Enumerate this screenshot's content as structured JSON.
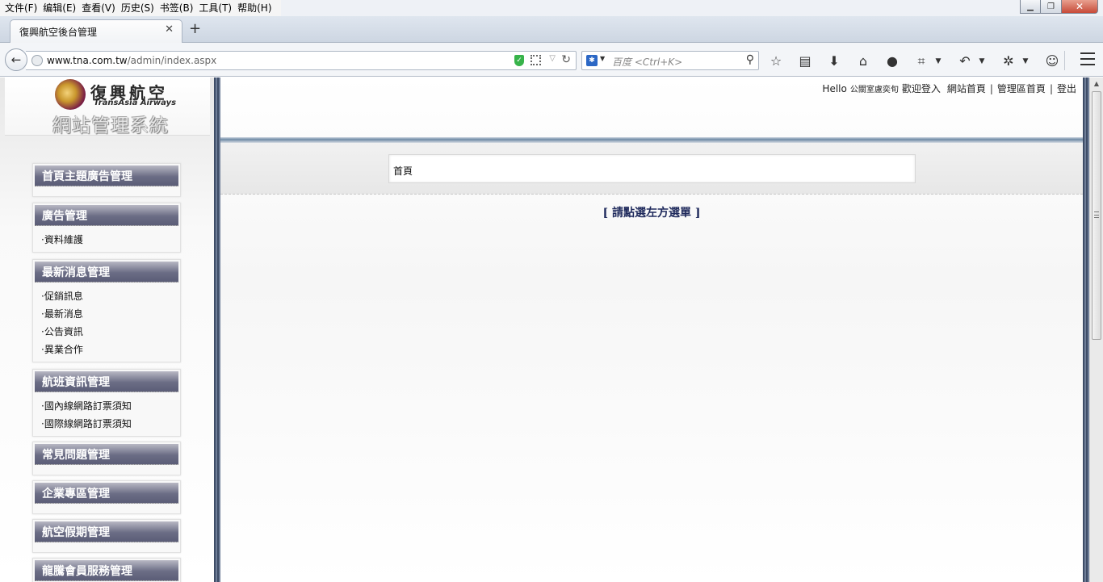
{
  "browser": {
    "menu": [
      "文件(F)",
      "编辑(E)",
      "查看(V)",
      "历史(S)",
      "书签(B)",
      "工具(T)",
      "帮助(H)"
    ],
    "tab_title": "復興航空後台管理",
    "url_host": "www.tna.com.tw",
    "url_path": "/admin/index.aspx",
    "search_placeholder": "百度 <Ctrl+K>"
  },
  "logo": {
    "name_cn": "復興航空",
    "name_en": "TransAsia Airways",
    "system_title": "網站管理系統"
  },
  "header": {
    "greeting": "Hello",
    "username": "公關室盧奕旬",
    "welcome": "歡迎登入",
    "links": [
      "網站首頁",
      "管理區首頁",
      "登出"
    ]
  },
  "breadcrumb": "首頁",
  "instruction": "[ 請點選左方選單 ]",
  "sidebar": {
    "groups": [
      {
        "title": "首頁主題廣告管理",
        "items": []
      },
      {
        "title": "廣告管理",
        "items": [
          "·資料維護"
        ]
      },
      {
        "title": "最新消息管理",
        "items": [
          "·促銷訊息",
          "·最新消息",
          "·公告資訊",
          "·異業合作"
        ]
      },
      {
        "title": "航班資訊管理",
        "items": [
          "·國內線網路訂票須知",
          "·國際線網路訂票須知"
        ]
      },
      {
        "title": "常見問題管理",
        "items": []
      },
      {
        "title": "企業專區管理",
        "items": []
      },
      {
        "title": "航空假期管理",
        "items": []
      },
      {
        "title": "龍騰會員服務管理",
        "items": []
      }
    ]
  },
  "colors": {
    "group_header": "#6b6d85",
    "divider": "#3e4d67",
    "instruction": "#1f2a5c"
  }
}
